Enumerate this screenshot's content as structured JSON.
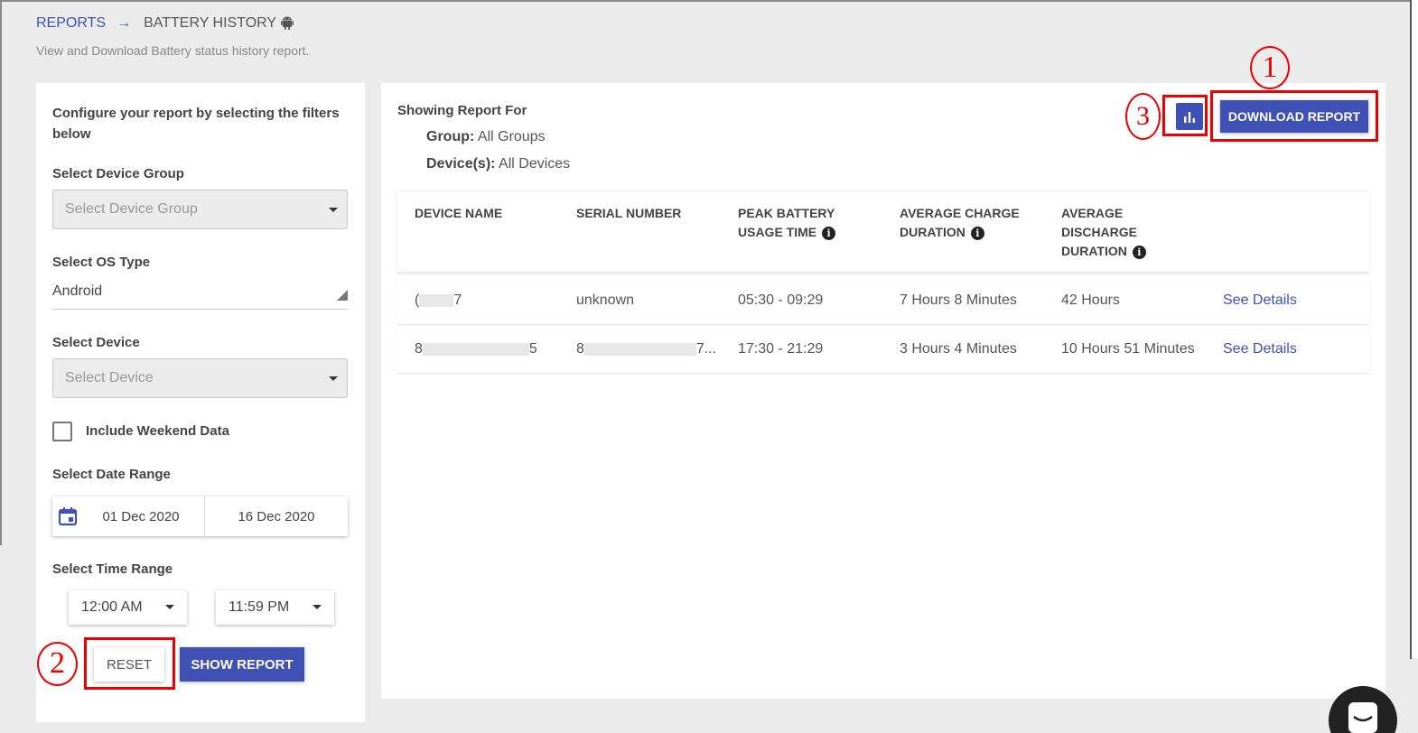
{
  "breadcrumb": {
    "parent": "REPORTS",
    "arrow": "→",
    "current": "BATTERY HISTORY"
  },
  "subtitle": "View and Download Battery status history report.",
  "filters": {
    "intro": "Configure your report by selecting the filters below",
    "device_group_label": "Select Device Group",
    "device_group_placeholder": "Select Device Group",
    "os_type_label": "Select OS Type",
    "os_type_value": "Android",
    "device_label": "Select Device",
    "device_placeholder": "Select Device",
    "weekend_label": "Include Weekend Data",
    "date_range_label": "Select Date Range",
    "date_start": "01 Dec 2020",
    "date_end": "16 Dec 2020",
    "time_range_label": "Select Time Range",
    "time_start": "12:00 AM",
    "time_end": "11:59 PM",
    "reset_label": "RESET",
    "show_label": "SHOW REPORT"
  },
  "report": {
    "showing_label": "Showing Report For",
    "group_key": "Group:",
    "group_value": "All Groups",
    "devices_key": "Device(s):",
    "devices_value": "All Devices",
    "download_label": "DOWNLOAD REPORT",
    "columns": {
      "device_name": "DEVICE NAME",
      "serial_number": "SERIAL NUMBER",
      "peak_1": "PEAK BATTERY",
      "peak_2": "USAGE TIME",
      "charge_1": "AVERAGE CHARGE",
      "charge_2": "DURATION",
      "discharge_1": "AVERAGE",
      "discharge_2": "DISCHARGE",
      "discharge_3": "DURATION"
    },
    "rows": [
      {
        "name_start": "(",
        "name_end": "7",
        "serial": "unknown",
        "peak": "05:30 - 09:29",
        "charge": "7 Hours 8 Minutes",
        "discharge": "42 Hours",
        "action": "See Details"
      },
      {
        "name_start": "8",
        "name_end": "5",
        "serial_start": "8",
        "serial_end": "7...",
        "peak": "17:30 - 21:29",
        "charge": "3 Hours 4 Minutes",
        "discharge": "10 Hours 51 Minutes",
        "action": "See Details"
      }
    ]
  },
  "annotations": {
    "one": "1",
    "two": "2",
    "three": "3"
  },
  "colors": {
    "primary": "#3f51b5",
    "annotation": "#ee0000"
  },
  "icons": {
    "os": "android-icon",
    "calendar": "calendar-icon",
    "chart": "bar-chart-icon",
    "info": "info-icon"
  }
}
